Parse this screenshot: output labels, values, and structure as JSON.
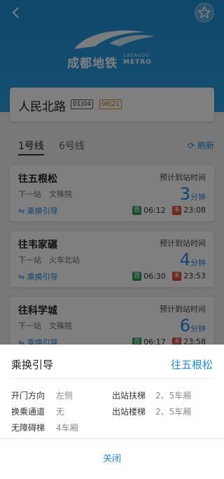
{
  "logo": {
    "cn": "成都地铁",
    "en1": "CHENGDU",
    "en2": "METRO"
  },
  "station": {
    "name": "人民北路",
    "code1": "01|04",
    "code2": "06|21"
  },
  "tabs": [
    {
      "label": "1号线",
      "active": true
    },
    {
      "label": "6号线",
      "active": false
    }
  ],
  "refresh_label": "刷新",
  "trains": [
    {
      "dest": "往五根松",
      "next": "下一站　文殊院",
      "transfer": "乘换引导",
      "eta_label": "预计到站时间",
      "eta": "3",
      "unit": "分钟",
      "first_badge": "首",
      "first_time": "06:12",
      "last_badge": "末",
      "last_time": "23:08"
    },
    {
      "dest": "往韦家碾",
      "next": "下一站　火车北站",
      "transfer": "乘换引导",
      "eta_label": "预计到站时间",
      "eta": "4",
      "unit": "分钟",
      "first_badge": "首",
      "first_time": "06:30",
      "last_badge": "末",
      "last_time": "23:53"
    },
    {
      "dest": "往科学城",
      "next": "下一站　文殊院",
      "transfer": "乘换引导",
      "eta_label": "预计到站时间",
      "eta": "6",
      "unit": "分钟",
      "first_badge": "首",
      "first_time": "06:17",
      "last_badge": "末",
      "last_time": "23:58"
    }
  ],
  "sheet": {
    "title": "乘换引导",
    "dest": "往五根松",
    "rows": [
      {
        "l1": "开门方向",
        "v1": "左侧",
        "l2": "出站扶梯",
        "v2": "2、5车厢"
      },
      {
        "l1": "换乘通道",
        "v1": "无",
        "l2": "出站楼梯",
        "v2": "2、5车厢"
      },
      {
        "l1": "无障碍梯",
        "v1": "4车厢"
      }
    ],
    "close": "关闭"
  },
  "colors": {
    "accent": "#1e88e5",
    "first": "#2e9e5a",
    "last": "#e04a3a"
  }
}
